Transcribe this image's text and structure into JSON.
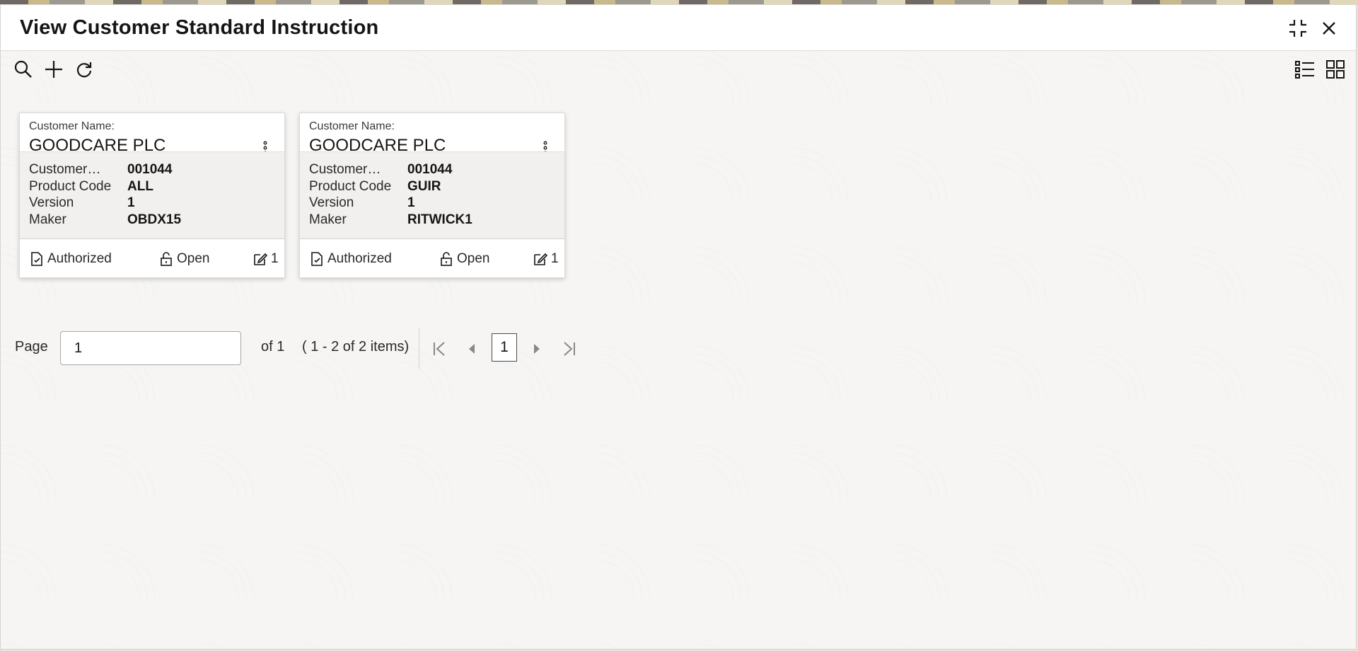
{
  "dialog": {
    "title": "View Customer Standard Instruction",
    "header_icons": [
      "minimize-icon",
      "close-icon"
    ]
  },
  "toolbar": {
    "left_icons": [
      "search-icon",
      "add-icon",
      "refresh-icon"
    ],
    "right_icons": [
      "list-view-icon",
      "tile-view-icon"
    ]
  },
  "cards": [
    {
      "customer_name_label": "Customer Name:",
      "customer_name": "GOODCARE PLC",
      "fields": [
        {
          "label": "Customer…",
          "value": "001044"
        },
        {
          "label": "Product Code",
          "value": "ALL"
        },
        {
          "label": "Version",
          "value": "1"
        },
        {
          "label": "Maker",
          "value": "OBDX15"
        }
      ],
      "auth_status": "Authorized",
      "record_status": "Open",
      "mod_count": "1"
    },
    {
      "customer_name_label": "Customer Name:",
      "customer_name": "GOODCARE PLC",
      "fields": [
        {
          "label": "Customer…",
          "value": "001044"
        },
        {
          "label": "Product Code",
          "value": "GUIR"
        },
        {
          "label": "Version",
          "value": "1"
        },
        {
          "label": "Maker",
          "value": "RITWICK1"
        }
      ],
      "auth_status": "Authorized",
      "record_status": "Open",
      "mod_count": "1"
    }
  ],
  "pagination": {
    "page_label": "Page",
    "page_value": "1",
    "of_label": "of 1",
    "items_label": "( 1 - 2 of 2 items)",
    "current_page": "1"
  }
}
